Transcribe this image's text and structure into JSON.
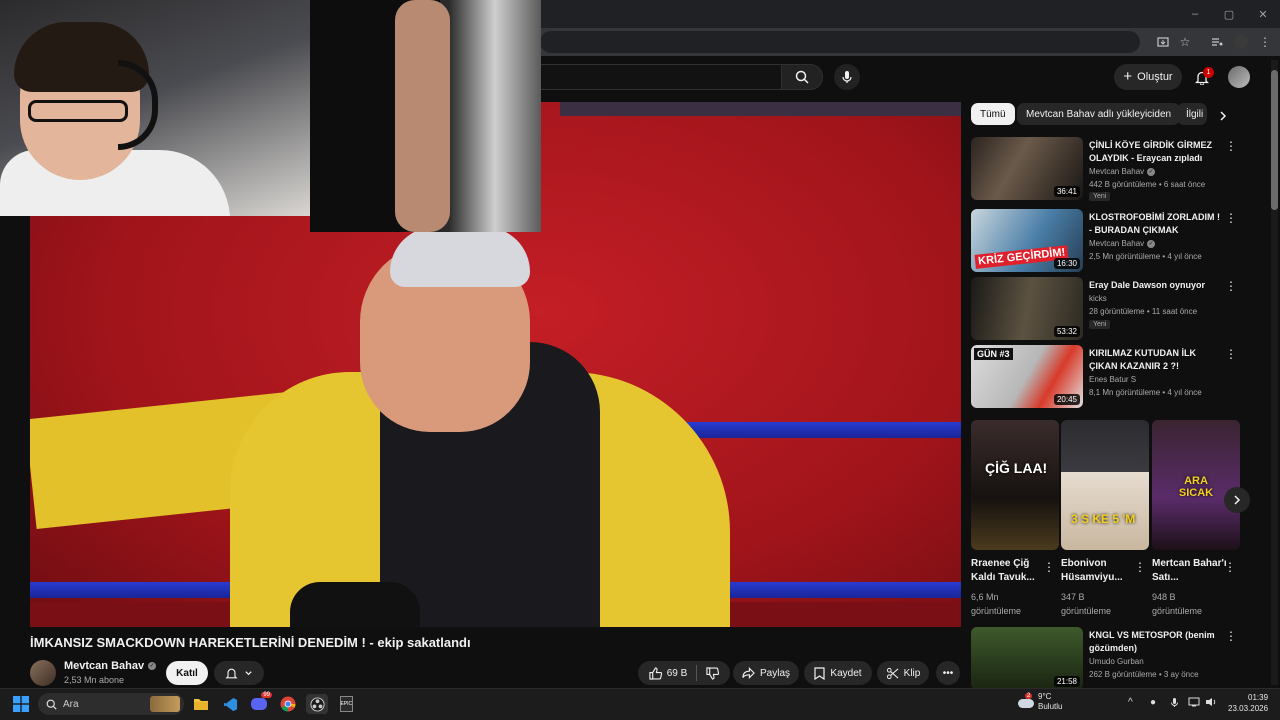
{
  "browser": {
    "window_controls": [
      "–",
      "▢",
      "✕"
    ]
  },
  "youtube_header": {
    "create_label": "Oluştur",
    "notification_count": "1"
  },
  "video": {
    "title": "İMKANSIZ SMACKDOWN HAREKETLERİNİ DENEDİM ! - ekip sakatlandı",
    "channel_name": "Mevtcan Bahav",
    "subscribers": "2,53 Mn abone",
    "join_label": "Katıl",
    "likes": "69 B",
    "share_label": "Paylaş",
    "save_label": "Kaydet",
    "clip_label": "Klip"
  },
  "chips": [
    {
      "label": "Tümü",
      "active": true
    },
    {
      "label": "Mevtcan Bahav adlı yükleyiciden",
      "active": false
    },
    {
      "label": "İlgili",
      "active": false
    }
  ],
  "recommendations": [
    {
      "title": "ÇİNLİ KÖYE GİRDİK GİRMEZ OLAYDIK - Eraycan zıpladı",
      "channel": "Mevtcan Bahav",
      "verified": true,
      "meta": "442 B görüntüleme • 6 saat önce",
      "badge": "Yeni",
      "duration": "36:41"
    },
    {
      "title": "KLOSTROFOBİMİ ZORLADIM ! - BURADAN ÇIKMAK İMKANSIZ",
      "channel": "Mevtcan Bahav",
      "verified": true,
      "meta": "2,5 Mn görüntüleme • 4 yıl önce",
      "badge": "",
      "duration": "16:30",
      "thumb_text": "KRİZ GEÇİRDİM!"
    },
    {
      "title": "Eray Dale Dawson oynuyor",
      "channel": "kicks",
      "verified": false,
      "meta": "28 görüntüleme • 11 saat önce",
      "badge": "Yeni",
      "duration": "53:32"
    },
    {
      "title": "KIRILMAZ KUTUDAN İLK ÇIKAN KAZANIR 2 ?! (Hapishane ...",
      "channel": "Enes Batur S",
      "verified": false,
      "meta": "8,1 Mn görüntüleme • 4 yıl önce",
      "badge": "",
      "duration": "20:45",
      "thumb_text": "GÜN #3"
    },
    {
      "title": "KNGL VS METOSPOR (benim gözümden)",
      "channel": "Umudo Gurban",
      "verified": false,
      "meta": "262 B görüntüleme • 3 ay önce",
      "badge": "",
      "duration": "21:58"
    }
  ],
  "shorts": [
    {
      "title": "Rraenee Çiğ Kaldı Tavuk...",
      "views_line1": "6,6 Mn",
      "views_line2": "görüntüleme",
      "thumb_text": "ÇİĞ LAA!"
    },
    {
      "title": "Ebonivon Hüsamviyu...",
      "views_line1": "347 B",
      "views_line2": "görüntüleme",
      "thumb_text": "3 S KE 5 'M"
    },
    {
      "title": "Mertcan Bahar'ı Satı...",
      "views_line1": "948 B",
      "views_line2": "görüntüleme",
      "thumb_text": "ARA SICAK"
    }
  ],
  "taskbar": {
    "search_label": "Ara",
    "weather_temp": "9°C",
    "weather_desc": "Bulutlu",
    "weather_badge": "2",
    "time": "01:39",
    "date": "23.03.2026",
    "discord_badge": "99"
  },
  "colors": {
    "background": "#0f0f0f",
    "accent_red": "#cc0000",
    "chip_bg": "#272727"
  },
  "icons": [
    "search-icon",
    "mic-icon",
    "plus-icon",
    "bell-icon",
    "like-icon",
    "dislike-icon",
    "share-icon",
    "save-icon",
    "clip-icon",
    "more-icon",
    "chevron-right-icon",
    "windows-start-icon",
    "file-explorer-icon",
    "chrome-icon",
    "discord-icon",
    "epic-games-icon",
    "obs-icon",
    "vscode-icon",
    "weather-icon",
    "wifi-icon",
    "volume-icon",
    "battery-icon"
  ]
}
